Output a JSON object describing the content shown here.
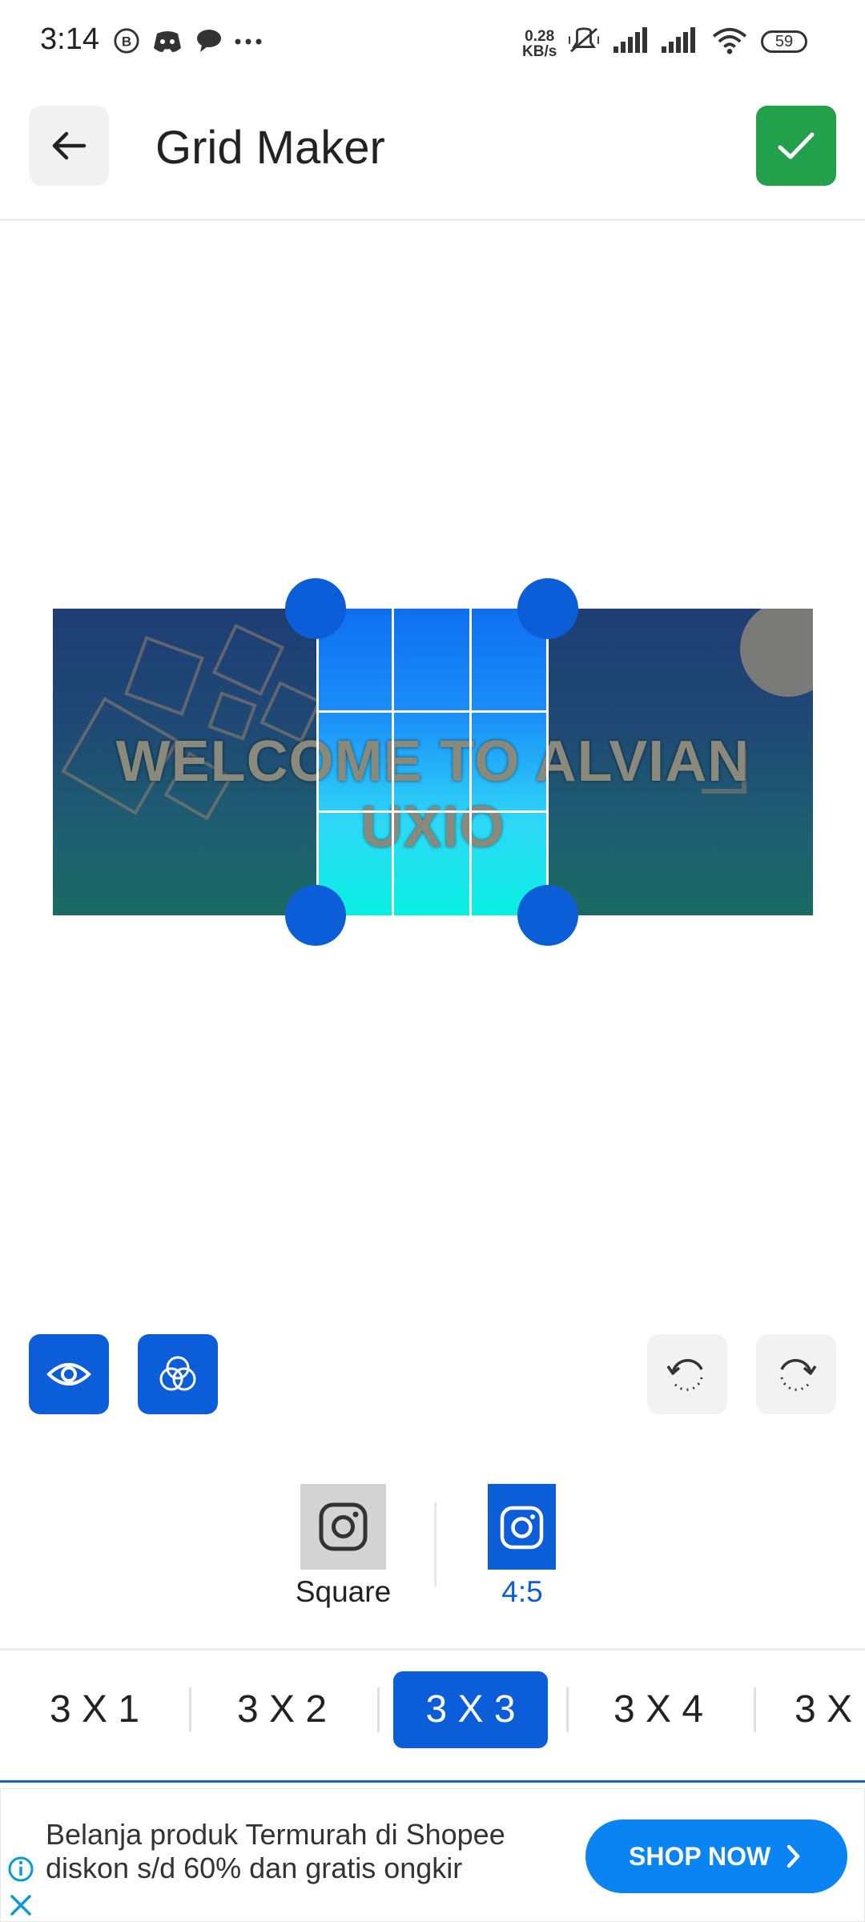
{
  "status_bar": {
    "time": "3:14",
    "net_speed_value": "0.28",
    "net_speed_unit": "KB/s",
    "battery": "59",
    "icons": [
      "b-badge-icon",
      "discord-icon",
      "chat-bubble-icon",
      "more-dots-icon",
      "mute-vibrate-icon",
      "signal-icon",
      "signal-icon",
      "wifi-icon",
      "battery-icon"
    ]
  },
  "header": {
    "title": "Grid Maker",
    "back_icon": "arrow-left-icon",
    "confirm_icon": "check-icon"
  },
  "canvas": {
    "banner_text": "WELCOME TO ALVIAN UXIO",
    "grid": "3 X 3"
  },
  "tools": {
    "left": [
      "eye-icon",
      "color-circles-icon"
    ],
    "right": [
      "rotate-left-icon",
      "rotate-right-icon"
    ]
  },
  "ratio": {
    "options": [
      {
        "label": "Square",
        "icon": "instagram-icon",
        "selected": false
      },
      {
        "label": "4:5",
        "icon": "instagram-icon",
        "selected": true
      }
    ]
  },
  "grid_options": {
    "items": [
      "3 X 1",
      "3 X 2",
      "3 X 3",
      "3 X 4",
      "3 X"
    ],
    "selected": "3 X 3"
  },
  "ad": {
    "text": "Belanja produk Termurah di Shopee diskon s/d 60% dan gratis ongkir",
    "button": "SHOP NOW"
  },
  "colors": {
    "accent": "#0b5ed7",
    "confirm": "#22a04b",
    "ad_button": "#0a84f2"
  }
}
